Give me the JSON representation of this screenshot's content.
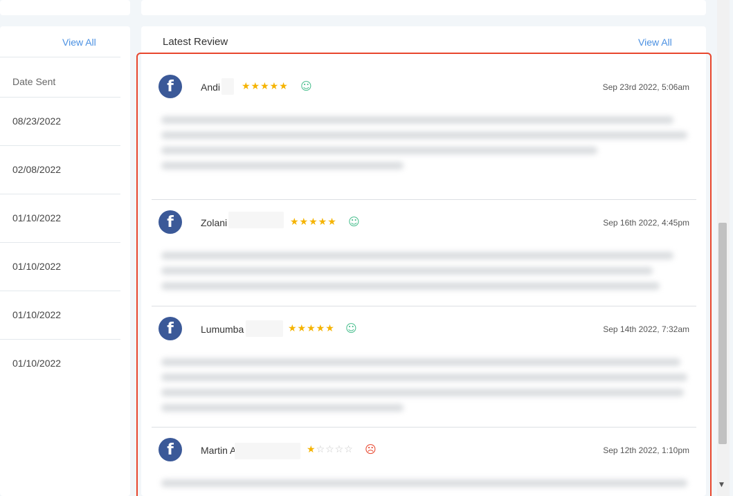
{
  "left_panel": {
    "view_all_label": "View All",
    "header": "Date Sent",
    "dates": [
      "08/23/2022",
      "02/08/2022",
      "01/10/2022",
      "01/10/2022",
      "01/10/2022",
      "01/10/2022"
    ]
  },
  "latest_review": {
    "title": "Latest Review",
    "view_all_label": "View All",
    "reviews": [
      {
        "name": "Andi",
        "rating": 5,
        "max_rating": 5,
        "sentiment": "positive",
        "date": "Sep 23rd 2022, 5:06am",
        "source": "facebook"
      },
      {
        "name": "Zolani",
        "rating": 5,
        "max_rating": 5,
        "sentiment": "positive",
        "date": "Sep 16th 2022, 4:45pm",
        "source": "facebook"
      },
      {
        "name": "Lumumba",
        "rating": 5,
        "max_rating": 5,
        "sentiment": "positive",
        "date": "Sep 14th 2022, 7:32am",
        "source": "facebook"
      },
      {
        "name": "Martin A",
        "rating": 1,
        "max_rating": 5,
        "sentiment": "negative",
        "date": "Sep 12th 2022, 1:10pm",
        "source": "facebook"
      }
    ]
  },
  "icons": {
    "facebook": "facebook-icon",
    "happy": "smiley-icon",
    "sad": "frown-icon",
    "star": "star-icon"
  },
  "colors": {
    "accent": "#4a90e2",
    "highlight": "#e8452c",
    "star": "#f5b301",
    "facebook": "#3b5998",
    "positive": "#4bbf8f",
    "negative": "#e8452c"
  }
}
